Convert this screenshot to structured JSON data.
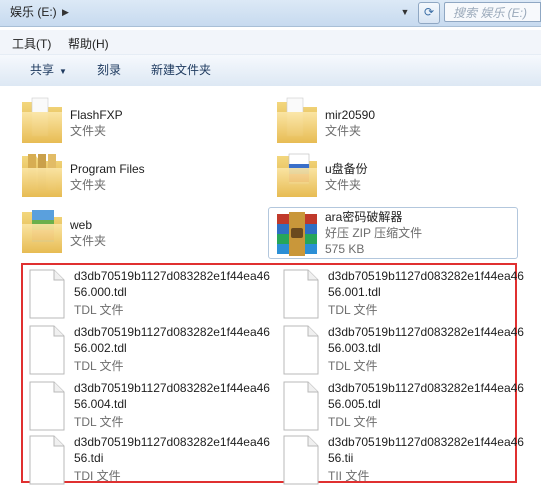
{
  "address": {
    "path": "娱乐 (E:)",
    "search_placeholder": "搜索 娱乐 (E:)"
  },
  "menu": {
    "tools": "工具(T)",
    "help": "帮助(H)"
  },
  "toolbar": {
    "share": "共享",
    "burn": "刻录",
    "new_folder": "新建文件夹"
  },
  "folders": [
    {
      "name": "FlashFXP",
      "type": "文件夹"
    },
    {
      "name": "mir20590",
      "type": "文件夹"
    },
    {
      "name": "Program Files",
      "type": "文件夹"
    },
    {
      "name": "u盘备份",
      "type": "文件夹"
    },
    {
      "name": "web",
      "type": "文件夹"
    }
  ],
  "archive": {
    "name": "ara密码破解器",
    "type": "好压 ZIP 压缩文件",
    "size": "575 KB"
  },
  "files": [
    {
      "line1": "d3db70519b1127d083282e1f44ea46",
      "line2": "56.000.tdl",
      "type": "TDL 文件"
    },
    {
      "line1": "d3db70519b1127d083282e1f44ea46",
      "line2": "56.001.tdl",
      "type": "TDL 文件"
    },
    {
      "line1": "d3db70519b1127d083282e1f44ea46",
      "line2": "56.002.tdl",
      "type": "TDL 文件"
    },
    {
      "line1": "d3db70519b1127d083282e1f44ea46",
      "line2": "56.003.tdl",
      "type": "TDL 文件"
    },
    {
      "line1": "d3db70519b1127d083282e1f44ea46",
      "line2": "56.004.tdl",
      "type": "TDL 文件"
    },
    {
      "line1": "d3db70519b1127d083282e1f44ea46",
      "line2": "56.005.tdl",
      "type": "TDL 文件"
    },
    {
      "line1": "d3db70519b1127d083282e1f44ea46",
      "line2": "56.tdi",
      "type": "TDI 文件"
    },
    {
      "line1": "d3db70519b1127d083282e1f44ea46",
      "line2": "56.tii",
      "type": "TII 文件"
    }
  ]
}
